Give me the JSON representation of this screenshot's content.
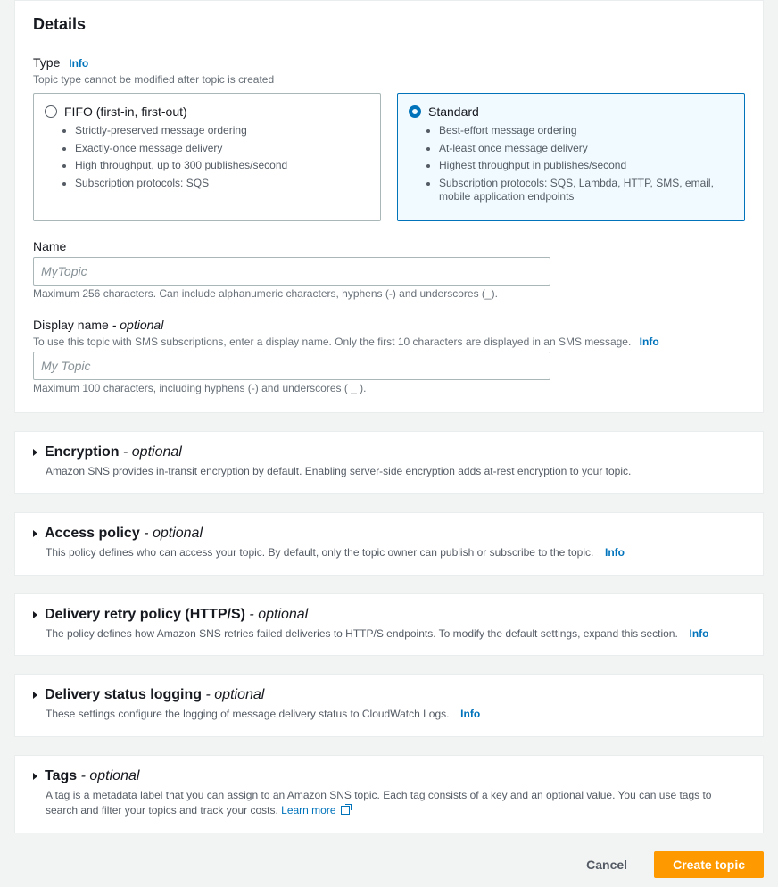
{
  "details": {
    "title": "Details",
    "type": {
      "label": "Type",
      "info": "Info",
      "hint": "Topic type cannot be modified after topic is created",
      "fifo": {
        "title": "FIFO (first-in, first-out)",
        "b1": "Strictly-preserved message ordering",
        "b2": "Exactly-once message delivery",
        "b3": "High throughput, up to 300 publishes/second",
        "b4": "Subscription protocols: SQS"
      },
      "standard": {
        "title": "Standard",
        "b1": "Best-effort message ordering",
        "b2": "At-least once message delivery",
        "b3": "Highest throughput in publishes/second",
        "b4": "Subscription protocols: SQS, Lambda, HTTP, SMS, email, mobile application endpoints"
      }
    },
    "name": {
      "label": "Name",
      "placeholder": "MyTopic",
      "hint": "Maximum 256 characters. Can include alphanumeric characters, hyphens (-) and underscores (_)."
    },
    "displayName": {
      "label": "Display name",
      "optional": " - optional",
      "hint": "To use this topic with SMS subscriptions, enter a display name. Only the first 10 characters are displayed in an SMS message.",
      "info": "Info",
      "placeholder": "My Topic",
      "belowHint": "Maximum 100 characters, including hyphens (-) and underscores ( _ )."
    }
  },
  "sections": {
    "encryption": {
      "title": "Encryption",
      "optional": " - optional",
      "desc": "Amazon SNS provides in-transit encryption by default. Enabling server-side encryption adds at-rest encryption to your topic."
    },
    "accessPolicy": {
      "title": "Access policy",
      "optional": " - optional",
      "desc": "This policy defines who can access your topic. By default, only the topic owner can publish or subscribe to the topic.",
      "info": "Info"
    },
    "deliveryRetry": {
      "title": "Delivery retry policy (HTTP/S)",
      "optional": " - optional",
      "desc": "The policy defines how Amazon SNS retries failed deliveries to HTTP/S endpoints. To modify the default settings, expand this section.",
      "info": "Info"
    },
    "deliveryStatus": {
      "title": "Delivery status logging",
      "optional": " - optional",
      "desc": "These settings configure the logging of message delivery status to CloudWatch Logs.",
      "info": "Info"
    },
    "tags": {
      "title": "Tags",
      "optional": " - optional",
      "desc": "A tag is a metadata label that you can assign to an Amazon SNS topic. Each tag consists of a key and an optional value. You can use tags to search and filter your topics and track your costs.",
      "learnMore": "Learn more"
    }
  },
  "footer": {
    "cancel": "Cancel",
    "create": "Create topic"
  }
}
